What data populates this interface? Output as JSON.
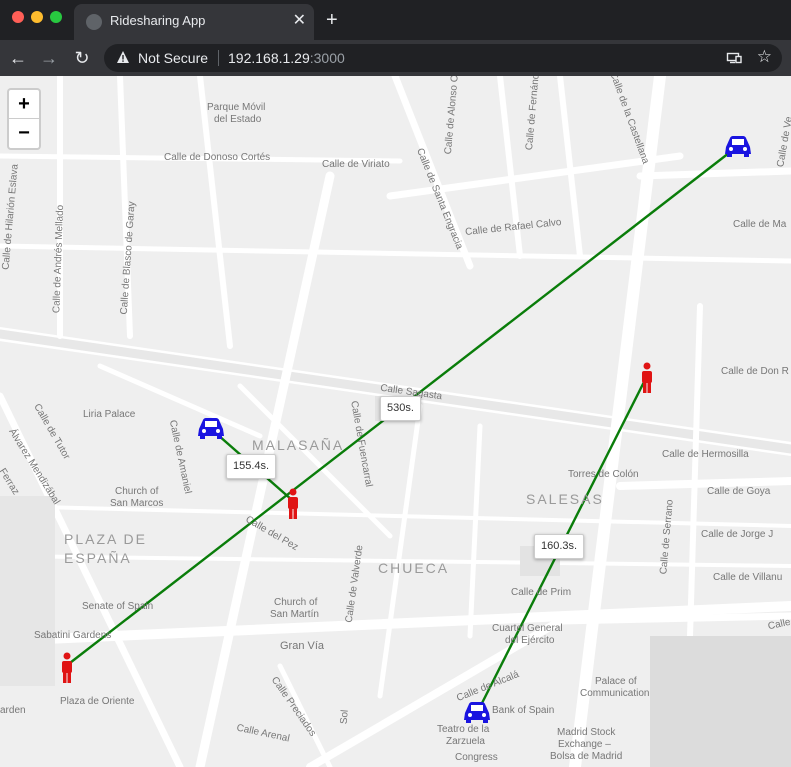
{
  "browser": {
    "tab_title": "Ridesharing App",
    "new_tab": "+",
    "close_tab": "✕",
    "security_label": "Not Secure",
    "url_host": "192.168.1.29",
    "url_port": ":3000",
    "back": "←",
    "forward": "→",
    "reload": "↻",
    "bookmark": "☆"
  },
  "map": {
    "zoom_in": "+",
    "zoom_out": "−",
    "area_labels": [
      "MALASAÑA",
      "PLAZA DE",
      "ESPAÑA",
      "CHUECA",
      "SALESAS"
    ],
    "street_labels": [
      "Parque Móvil",
      "del Estado",
      "Calle de Donoso Cortés",
      "Calle de Viriato",
      "Calle de Rafael Calvo",
      "Calle de Ma",
      "Calle de Don R",
      "Calle de Hermosilla",
      "Torres de Colón",
      "Calle de Goya",
      "Calle de Jorge J",
      "Calle de Villanu",
      "Calle de Prim",
      "Cuartel General",
      "del Ejército",
      "Calle de Alcalá",
      "Palace of",
      "Communication",
      "Bank of Spain",
      "Madrid Stock",
      "Exchange –",
      "Bolsa de Madrid",
      "Teatro de la",
      "Zarzuela",
      "Congress",
      "Gran Vía",
      "Calle Arenal",
      "Plaza de Oriente",
      "Sabatini Gardens",
      "Senate of Spain",
      "Church of",
      "San Martín",
      "Church of",
      "San Marcos",
      "Liria Palace",
      "Calle del Pez",
      "Calle Sagasta",
      "Calle de Santa Engracia",
      "Calle de Alonso Ca",
      "Calle de Fernánd",
      "Calle de la Castellana",
      "Calle de Hilarión Eslava",
      "Calle de Andrés Mellado",
      "Calle de Blasco de Garay",
      "Calle de Tutor",
      "Calle de Amaniel",
      "Calle de Fuencarral",
      "Calle de Valverde",
      "Calle Preciados",
      "Calle de Serrano",
      "Calle de Ve",
      "Calle",
      "arden",
      "Sol",
      "Álvarez Mendizábal",
      "Ferraz"
    ],
    "eta_labels": [
      "530s.",
      "155.4s.",
      "160.3s."
    ],
    "colors": {
      "route": "#0a7d0a",
      "car": "#1a14e0",
      "rider": "#e01414"
    },
    "icons": [
      "car-icon",
      "rider-icon"
    ]
  }
}
